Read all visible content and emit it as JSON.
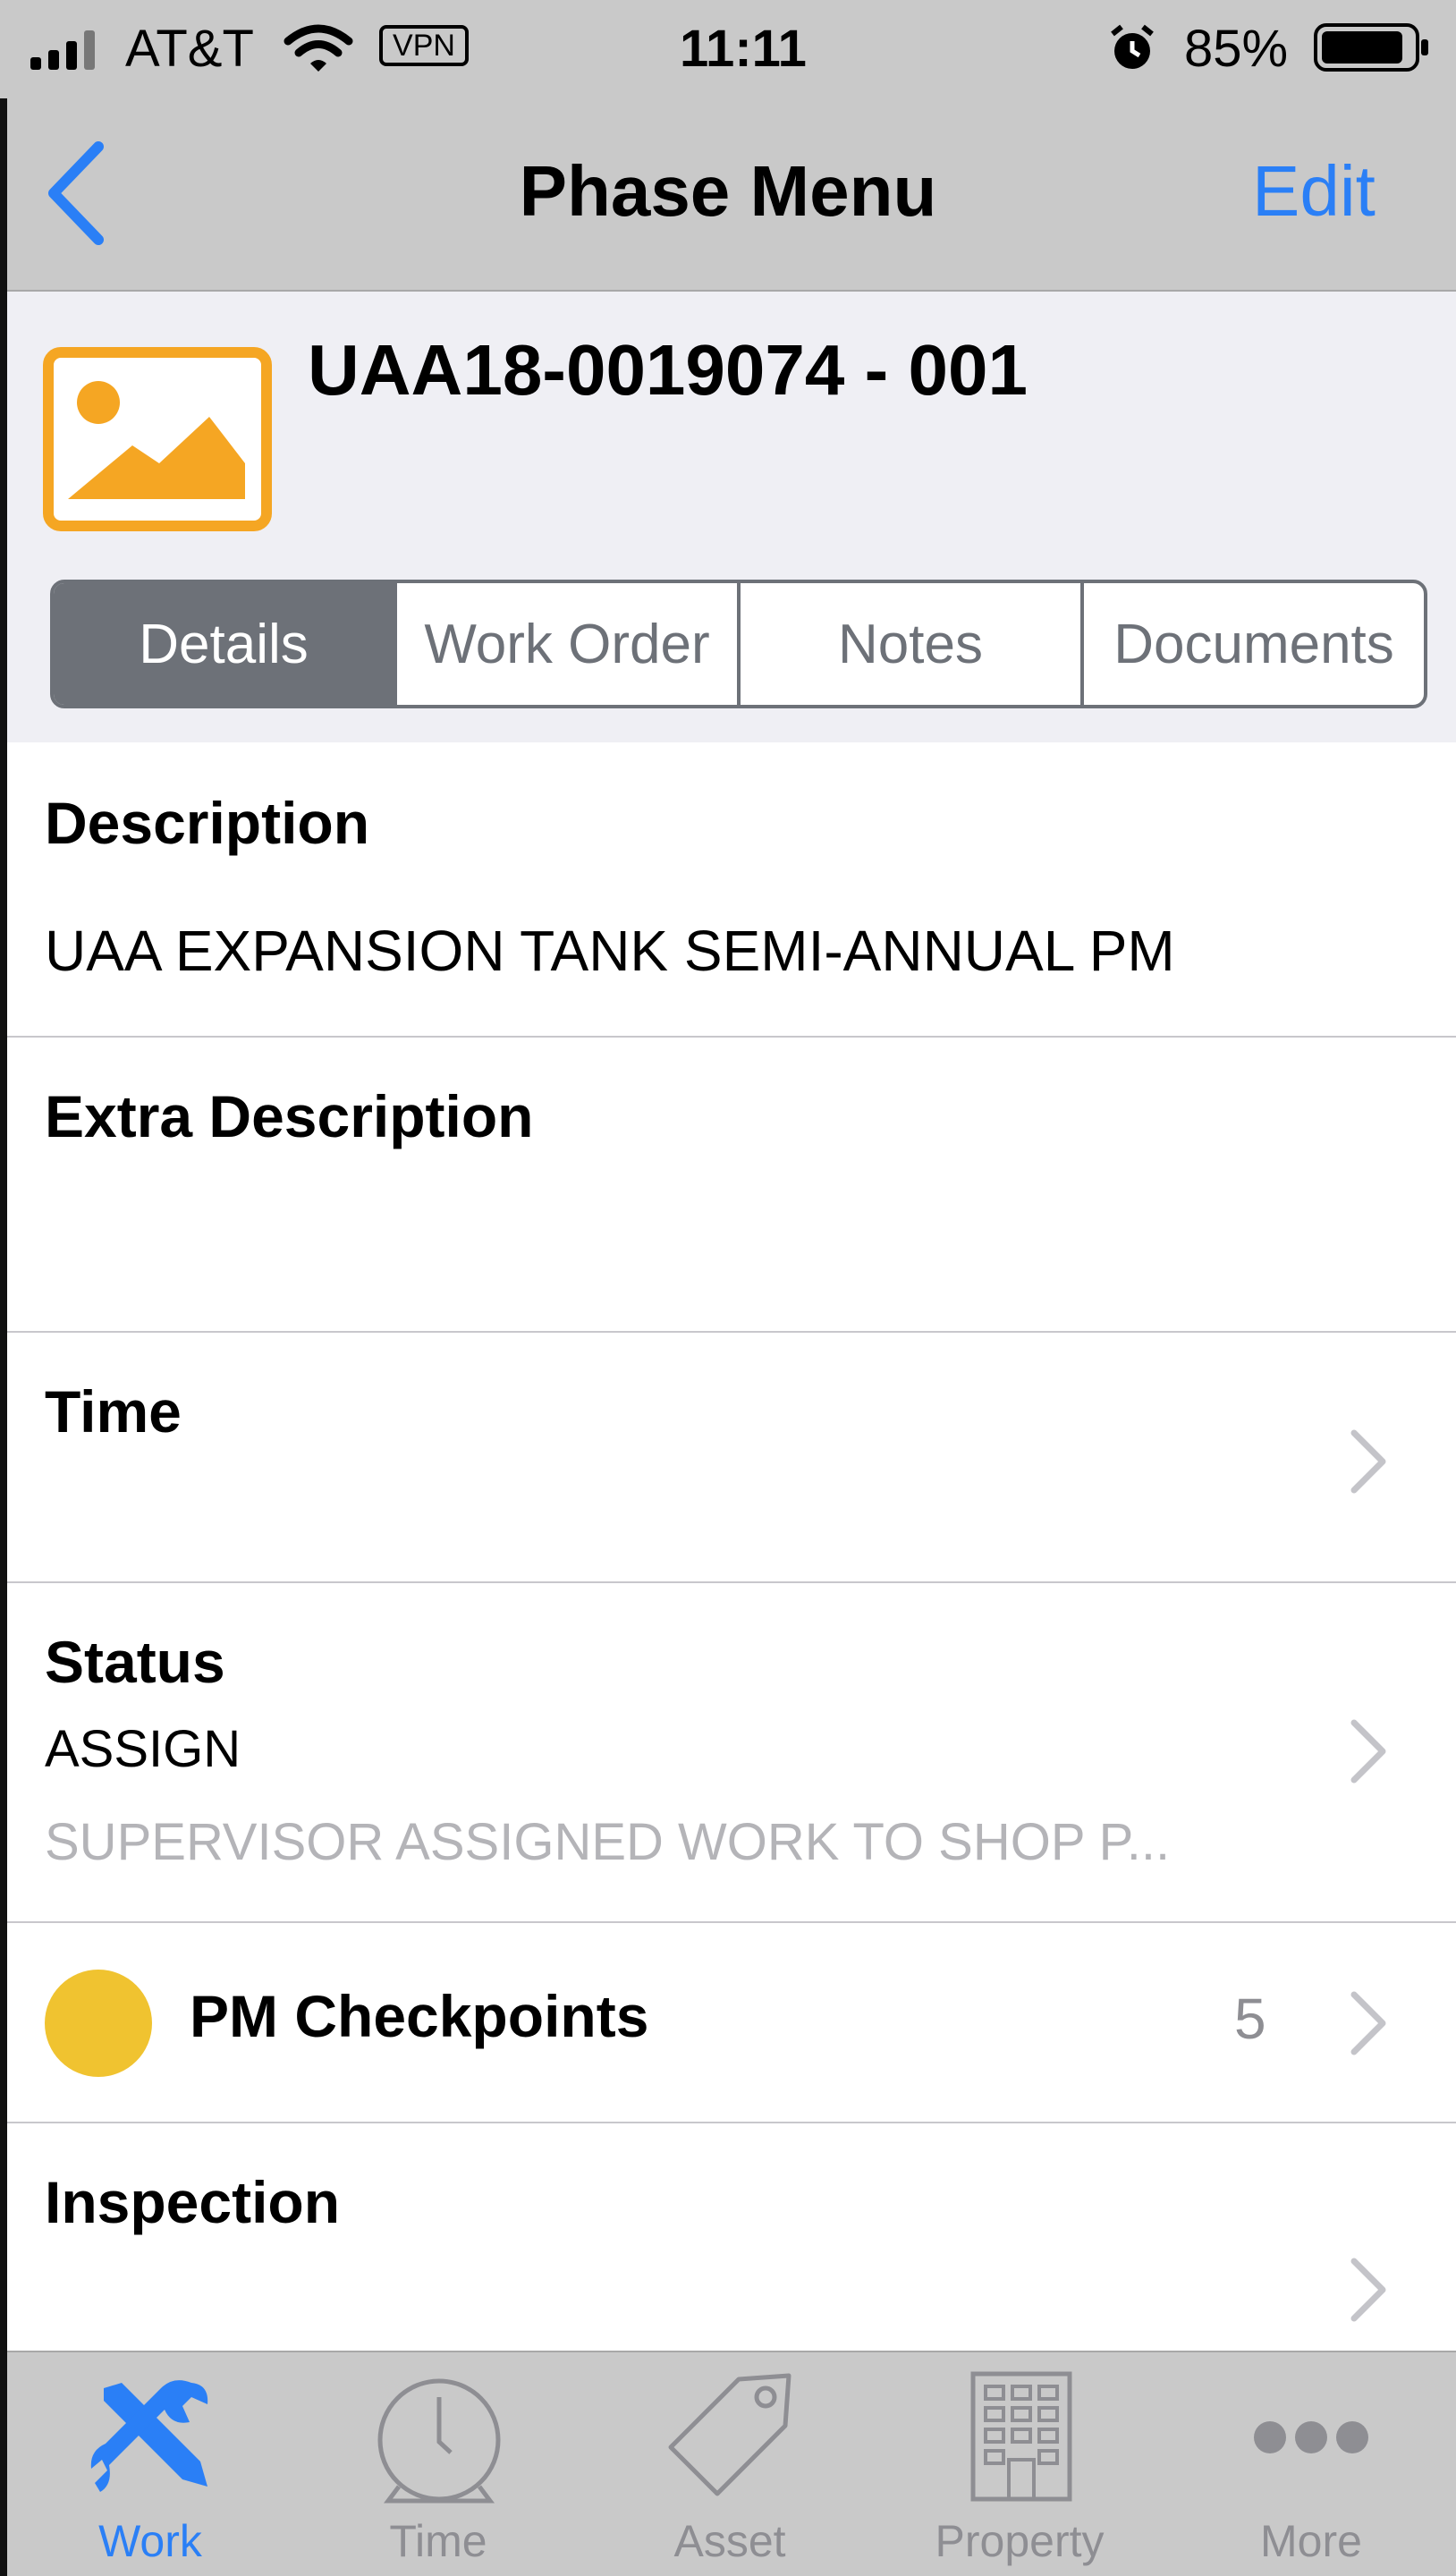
{
  "status_bar": {
    "carrier": "AT&T",
    "vpn": "VPN",
    "time": "11:11",
    "battery": "85%"
  },
  "nav": {
    "title": "Phase Menu",
    "edit_label": "Edit",
    "back_icon": "chevron-left-icon"
  },
  "header": {
    "record_id": "UAA18-0019074 - 001",
    "thumbnail_icon": "image-placeholder-icon"
  },
  "tabs": [
    {
      "label": "Details",
      "active": true
    },
    {
      "label": "Work Order",
      "active": false
    },
    {
      "label": "Notes",
      "active": false
    },
    {
      "label": "Documents",
      "active": false
    }
  ],
  "rows": {
    "description": {
      "label": "Description",
      "value": "UAA EXPANSION TANK SEMI-ANNUAL PM"
    },
    "extra_description": {
      "label": "Extra Description",
      "value": ""
    },
    "time": {
      "label": "Time"
    },
    "status": {
      "label": "Status",
      "value": "ASSIGN",
      "detail": "SUPERVISOR ASSIGNED WORK TO SHOP P..."
    },
    "pm_checkpoints": {
      "label": "PM Checkpoints",
      "count": "5",
      "indicator_color": "#f0c330"
    },
    "inspection": {
      "label": "Inspection"
    }
  },
  "tabbar": [
    {
      "label": "Work",
      "icon": "wrench-screwdriver-icon",
      "active": true
    },
    {
      "label": "Time",
      "icon": "stopwatch-icon",
      "active": false
    },
    {
      "label": "Asset",
      "icon": "tag-icon",
      "active": false
    },
    {
      "label": "Property",
      "icon": "building-icon",
      "active": false
    },
    {
      "label": "More",
      "icon": "more-dots-icon",
      "active": false
    }
  ],
  "colors": {
    "accent": "#2a7ff6",
    "thumbnail": "#f5a623",
    "bar_background": "#c9c9c9",
    "inactive_tab": "#8e8e93"
  }
}
